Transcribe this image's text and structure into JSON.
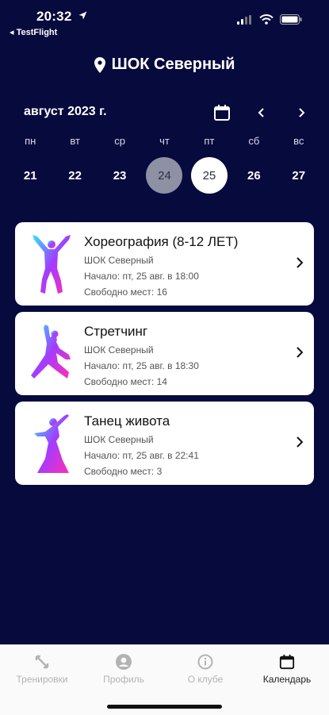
{
  "status_bar": {
    "time": "20:32",
    "back_app": "◂ TestFlight"
  },
  "header": {
    "title": "ШОК Северный"
  },
  "calendar": {
    "month": "август 2023 г.",
    "weekdays": [
      "пн",
      "вт",
      "ср",
      "чт",
      "пт",
      "сб",
      "вс"
    ],
    "days": [
      "21",
      "22",
      "23",
      "24",
      "25",
      "26",
      "27"
    ],
    "today_day": "24",
    "selected_day": "25"
  },
  "classes": [
    {
      "name": "Хореография (8-12 ЛЕТ)",
      "location": "ШОК Северный",
      "start": "Начало: пт, 25 авг. в 18:00",
      "spots": "Свободно мест: 16",
      "icon": "dancer-jump-icon"
    },
    {
      "name": "Стретчинг",
      "location": "ШОК Северный",
      "start": "Начало: пт, 25 авг. в 18:30",
      "spots": "Свободно мест: 14",
      "icon": "dancer-stretch-icon"
    },
    {
      "name": "Танец живота",
      "location": "ШОК Северный",
      "start": "Начало: пт, 25 авг. в 22:41",
      "spots": "Свободно мест: 3",
      "icon": "belly-dancer-icon"
    }
  ],
  "tabbar": {
    "items": [
      {
        "label": "Тренировки",
        "icon": "workouts-icon"
      },
      {
        "label": "Профиль",
        "icon": "profile-icon"
      },
      {
        "label": "О клубе",
        "icon": "info-icon"
      },
      {
        "label": "Календарь",
        "icon": "calendar-icon"
      }
    ],
    "active": "Календарь"
  },
  "colors": {
    "background": "#070a3d",
    "card": "#ffffff",
    "today_circle": "#8e90a3",
    "gradient_start": "#2ee6ff",
    "gradient_end": "#ff2fb4"
  }
}
